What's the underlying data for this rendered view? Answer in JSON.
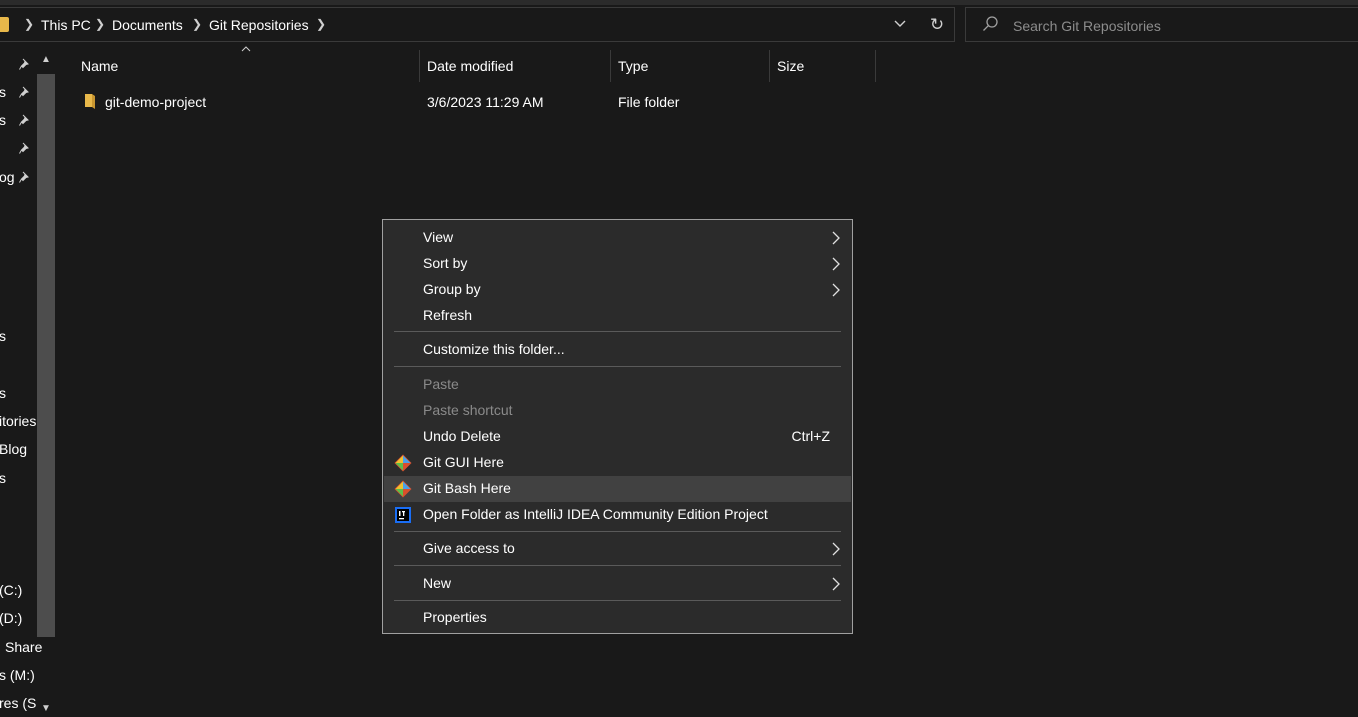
{
  "breadcrumb": [
    "This PC",
    "Documents",
    "Git Repositories"
  ],
  "search": {
    "placeholder": "Search Git Repositories"
  },
  "nav_fragments": [
    "s",
    "s",
    "og",
    "s",
    "s",
    "sitories",
    "Blog",
    "s",
    "(C:)",
    "(D:)",
    "Share",
    "s (M:)",
    "res (S:"
  ],
  "columns": [
    "Name",
    "Date modified",
    "Type",
    "Size"
  ],
  "files": [
    {
      "name": "git-demo-project",
      "date": "3/6/2023 11:29 AM",
      "type": "File folder",
      "size": ""
    }
  ],
  "context_menu": {
    "view": "View",
    "sort_by": "Sort by",
    "group_by": "Group by",
    "refresh": "Refresh",
    "customize": "Customize this folder...",
    "paste": "Paste",
    "paste_shortcut": "Paste shortcut",
    "undo_delete": "Undo Delete",
    "undo_shortcut": "Ctrl+Z",
    "git_gui": "Git GUI Here",
    "git_bash": "Git Bash Here",
    "intellij": "Open Folder as IntelliJ IDEA Community Edition Project",
    "give_access": "Give access to",
    "new": "New",
    "properties": "Properties"
  },
  "icons": {
    "folder": "folder-icon",
    "git": "git-icon",
    "intellij": "intellij-icon",
    "pin": "pin-icon",
    "search": "search-icon"
  },
  "colors": {
    "background": "#191919",
    "menu_bg": "#2b2b2b",
    "menu_hover": "#414141",
    "folder_yellow": "#e8b84a",
    "disabled_text": "#8a8a8a"
  }
}
